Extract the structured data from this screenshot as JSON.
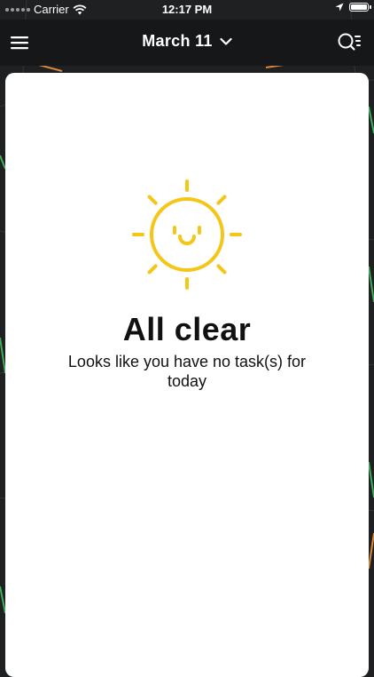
{
  "status_bar": {
    "carrier": "Carrier",
    "time": "12:17 PM"
  },
  "header": {
    "date": "March 11",
    "menu_icon": "hamburger-menu-icon",
    "dropdown_icon": "chevron-down-icon",
    "search_icon": "search-list-icon"
  },
  "empty_state": {
    "icon": "smiling-sun-icon",
    "title": "All clear",
    "message": "Looks like you have no task(s) for today"
  },
  "colors": {
    "sun": "#F5C518",
    "card": "#FFFFFF",
    "header_bg": "#161718",
    "map_bg": "#1F2021",
    "map_road_green": "#3FAE5A",
    "map_road_orange": "#D9893C"
  }
}
